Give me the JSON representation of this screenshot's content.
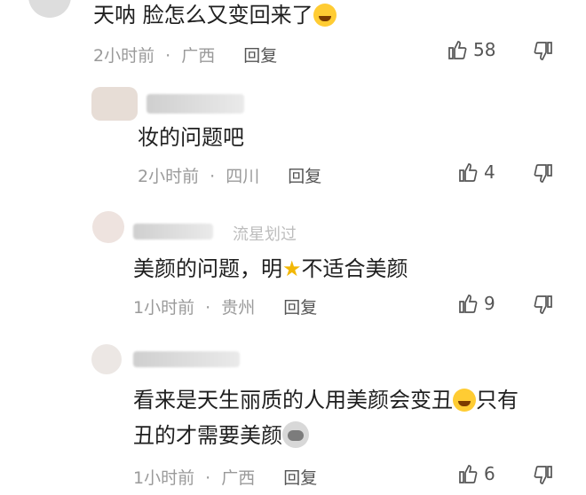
{
  "comments": [
    {
      "text_prefix": "天呐  脸怎么又变回来了",
      "time": "2小时前",
      "location": "广西",
      "reply_label": "回复",
      "likes": "58",
      "emoji": "laughing-tears"
    },
    {
      "username": "",
      "text": "妆的问题吧",
      "time": "2小时前",
      "location": "四川",
      "reply_label": "回复",
      "likes": "4"
    },
    {
      "username_tail": "流星划过",
      "text_a": "美颜的问题，明",
      "text_b": "不适合美颜",
      "time": "1小时前",
      "location": "贵州",
      "reply_label": "回复",
      "likes": "9",
      "emoji": "star"
    },
    {
      "text_line1_a": "看来是天生丽质的人用美颜会变丑",
      "text_line1_b": "只有",
      "text_line2": "丑的才需要美颜",
      "time": "1小时前",
      "location": "广西",
      "reply_label": "回复",
      "likes": "6",
      "emojis": [
        "laughing-tears",
        "dog"
      ]
    }
  ],
  "meta_separator": "·",
  "colors": {
    "text": "#1f1f1f",
    "meta": "#9a9a9a",
    "emoji_yellow": "#ffcc33",
    "star": "#f2b705"
  }
}
